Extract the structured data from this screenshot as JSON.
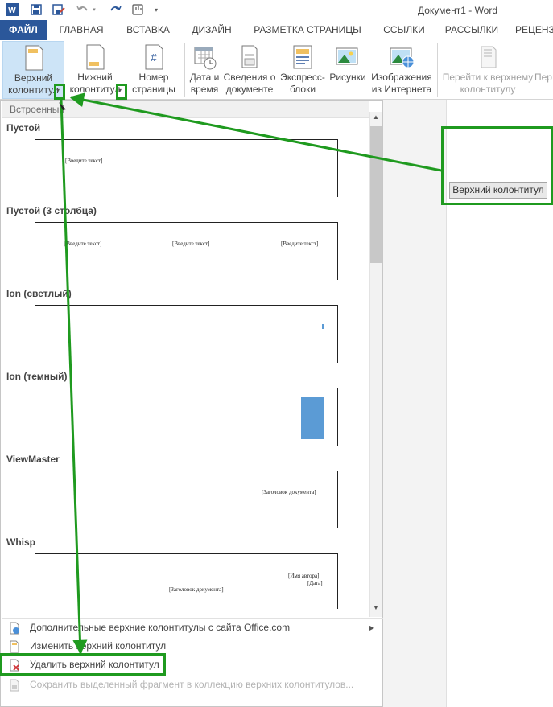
{
  "window": {
    "title": "Документ1 - Word"
  },
  "quick_access": {
    "icons": [
      "word-app-icon",
      "save-icon",
      "save-as-icon",
      "undo-icon",
      "redo-icon",
      "touch-mode-icon",
      "customize-qat-icon"
    ]
  },
  "tabs": [
    {
      "label": "ФАЙЛ",
      "active": true
    },
    {
      "label": "ГЛАВНАЯ"
    },
    {
      "label": "ВСТАВКА"
    },
    {
      "label": "ДИЗАЙН"
    },
    {
      "label": "РАЗМЕТКА СТРАНИЦЫ"
    },
    {
      "label": "ССЫЛКИ"
    },
    {
      "label": "РАССЫЛКИ"
    },
    {
      "label": "РЕЦЕНЗ"
    }
  ],
  "ribbon": {
    "header": {
      "line1": "Верхний",
      "line2": "колонтитул"
    },
    "footer": {
      "line1": "Нижний",
      "line2": "колонтитул"
    },
    "page_number": {
      "line1": "Номер",
      "line2": "страницы"
    },
    "date_time": {
      "line1": "Дата и",
      "line2": "время"
    },
    "doc_info": {
      "line1": "Сведения о",
      "line2": "документе"
    },
    "quick_parts": {
      "line1": "Экспресс-",
      "line2": "блоки"
    },
    "pictures": {
      "line1": "Рисунки",
      "line2": ""
    },
    "online_pictures": {
      "line1": "Изображения",
      "line2": "из Интернета"
    },
    "goto_header": {
      "line1": "Перейти к верхнему",
      "line2": "колонтитулу"
    },
    "next": {
      "line1": "Пер",
      "line2": ""
    }
  },
  "gallery": {
    "section_label": "Встроенный",
    "items": [
      {
        "title": "Пустой",
        "texts": [
          "[Введите текст]"
        ]
      },
      {
        "title": "Пустой (3 столбца)",
        "texts": [
          "[Введите текст]",
          "[Введите текст]",
          "[Введите текст]"
        ]
      },
      {
        "title": "Ion (светлый)",
        "texts": []
      },
      {
        "title": "Ion (темный)",
        "texts": []
      },
      {
        "title": "ViewMaster",
        "texts": [
          "[Заголовок документа]"
        ]
      },
      {
        "title": "Whisp",
        "texts": [
          "[Имя автора]",
          "[Дата]",
          "[Заголовок документа]"
        ]
      }
    ],
    "accent_color": "#5b9bd5"
  },
  "menu": [
    {
      "label": "Дополнительные верхние колонтитулы с сайта Office.com",
      "enabled": true,
      "has_submenu": true
    },
    {
      "label": "Изменить верхний колонтитул",
      "enabled": true
    },
    {
      "label": "Удалить верхний колонтитул",
      "enabled": true
    },
    {
      "label": "Сохранить выделенный фрагмент в коллекцию верхних колонтитулов...",
      "enabled": false
    }
  ],
  "document": {
    "header_tag": "Верхний колонтитул"
  },
  "colors": {
    "brand": "#2b579a",
    "annotation": "#1f9a1f",
    "selected_button": "#cde4f7"
  }
}
